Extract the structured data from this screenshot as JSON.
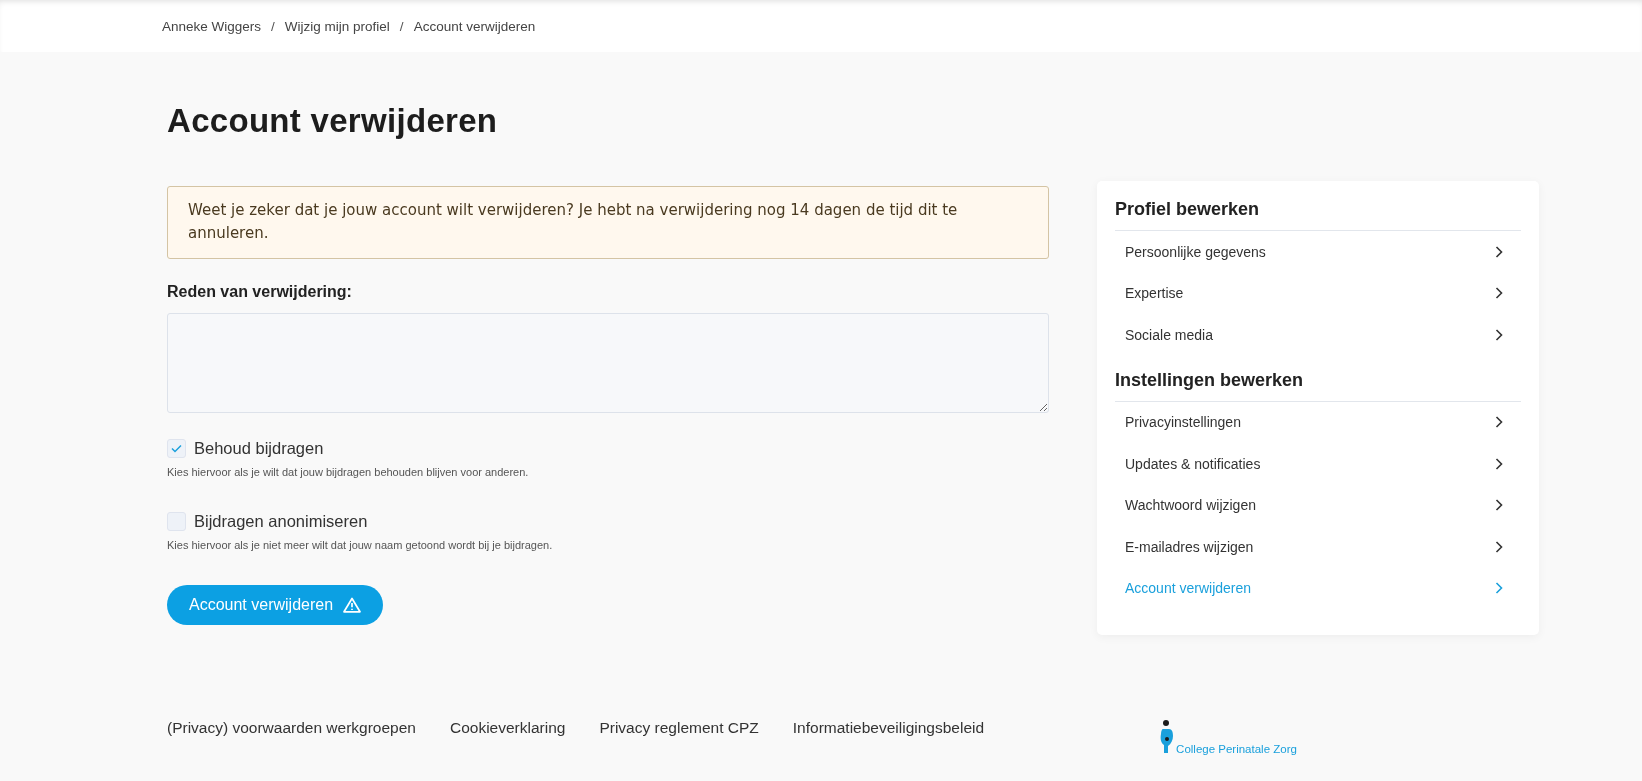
{
  "breadcrumb": [
    "Anneke Wiggers",
    "Wijzig mijn profiel",
    "Account verwijderen"
  ],
  "breadcrumb_separator": "/",
  "title": "Account verwijderen",
  "alert": "Weet je zeker dat je jouw account wilt verwijderen? Je hebt na verwijdering nog 14 dagen de tijd dit te annuleren.",
  "reason_label": "Reden van verwijdering:",
  "options": [
    {
      "label": "Behoud bijdragen",
      "help": "Kies hiervoor als je wilt dat jouw bijdragen behouden blijven voor anderen.",
      "checked": true
    },
    {
      "label": "Bijdragen anonimiseren",
      "help": "Kies hiervoor als je niet meer wilt dat jouw naam getoond wordt bij je bijdragen.",
      "checked": false
    }
  ],
  "submit_button": "Account verwijderen",
  "sidebar": {
    "sections": [
      {
        "heading": "Profiel bewerken",
        "items": [
          {
            "label": "Persoonlijke gegevens",
            "selected": false
          },
          {
            "label": "Expertise",
            "selected": false
          },
          {
            "label": "Sociale media",
            "selected": false
          }
        ]
      },
      {
        "heading": "Instellingen bewerken",
        "items": [
          {
            "label": "Privacyinstellingen",
            "selected": false
          },
          {
            "label": "Updates & notificaties",
            "selected": false
          },
          {
            "label": "Wachtwoord wijzigen",
            "selected": false
          },
          {
            "label": "E-mailadres wijzigen",
            "selected": false
          },
          {
            "label": "Account verwijderen",
            "selected": true
          }
        ]
      }
    ]
  },
  "footer": {
    "links": [
      "(Privacy) voorwaarden werkgroepen",
      "Cookieverklaring",
      "Privacy reglement CPZ",
      "Informatiebeveiligingsbeleid"
    ],
    "logo_text": "College Perinatale Zorg"
  }
}
